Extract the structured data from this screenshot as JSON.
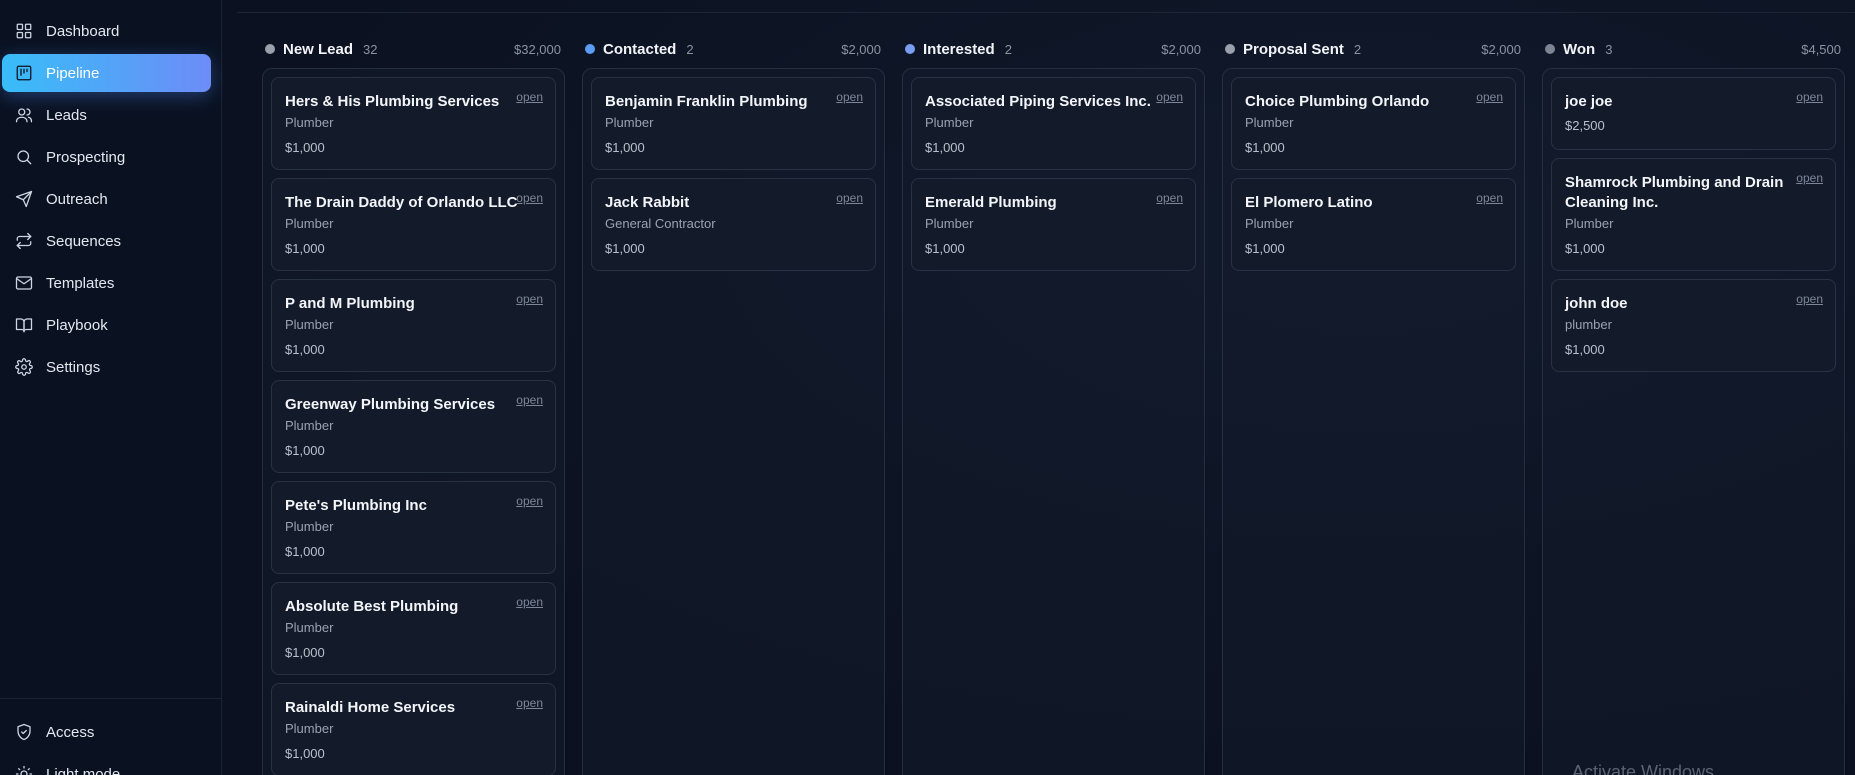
{
  "sidebar": {
    "items": [
      {
        "label": "Dashboard",
        "icon": "dashboard-icon",
        "active": false
      },
      {
        "label": "Pipeline",
        "icon": "pipeline-icon",
        "active": true
      },
      {
        "label": "Leads",
        "icon": "users-icon",
        "active": false
      },
      {
        "label": "Prospecting",
        "icon": "search-icon",
        "active": false
      },
      {
        "label": "Outreach",
        "icon": "send-icon",
        "active": false
      },
      {
        "label": "Sequences",
        "icon": "repeat-icon",
        "active": false
      },
      {
        "label": "Templates",
        "icon": "mail-icon",
        "active": false
      },
      {
        "label": "Playbook",
        "icon": "book-icon",
        "active": false
      },
      {
        "label": "Settings",
        "icon": "gear-icon",
        "active": false
      }
    ],
    "bottom": [
      {
        "label": "Access",
        "icon": "shield-icon"
      },
      {
        "label": "Light mode",
        "icon": "sun-icon"
      }
    ]
  },
  "columns": [
    {
      "title": "New Lead",
      "count": "32",
      "total": "$32,000",
      "dot_color": "#9aa1ad",
      "cards": [
        {
          "name": "Hers & His Plumbing Services",
          "type": "Plumber",
          "value": "$1,000",
          "action": "open"
        },
        {
          "name": "The Drain Daddy of Orlando LLC",
          "type": "Plumber",
          "value": "$1,000",
          "action": "open"
        },
        {
          "name": "P and M Plumbing",
          "type": "Plumber",
          "value": "$1,000",
          "action": "open"
        },
        {
          "name": "Greenway Plumbing Services",
          "type": "Plumber",
          "value": "$1,000",
          "action": "open"
        },
        {
          "name": "Pete's Plumbing Inc",
          "type": "Plumber",
          "value": "$1,000",
          "action": "open"
        },
        {
          "name": "Absolute Best Plumbing",
          "type": "Plumber",
          "value": "$1,000",
          "action": "open"
        },
        {
          "name": "Rainaldi Home Services",
          "type": "Plumber",
          "value": "$1,000",
          "action": "open"
        }
      ]
    },
    {
      "title": "Contacted",
      "count": "2",
      "total": "$2,000",
      "dot_color": "#5b9cf5",
      "cards": [
        {
          "name": "Benjamin Franklin Plumbing",
          "type": "Plumber",
          "value": "$1,000",
          "action": "open"
        },
        {
          "name": "Jack Rabbit",
          "type": "General Contractor",
          "value": "$1,000",
          "action": "open"
        }
      ]
    },
    {
      "title": "Interested",
      "count": "2",
      "total": "$2,000",
      "dot_color": "#7b9df0",
      "cards": [
        {
          "name": "Associated Piping Services Inc.",
          "type": "Plumber",
          "value": "$1,000",
          "action": "open"
        },
        {
          "name": "Emerald Plumbing",
          "type": "Plumber",
          "value": "$1,000",
          "action": "open"
        }
      ]
    },
    {
      "title": "Proposal Sent",
      "count": "2",
      "total": "$2,000",
      "dot_color": "#9aa1ad",
      "cards": [
        {
          "name": "Choice Plumbing Orlando",
          "type": "Plumber",
          "value": "$1,000",
          "action": "open"
        },
        {
          "name": "El Plomero Latino",
          "type": "Plumber",
          "value": "$1,000",
          "action": "open"
        }
      ]
    },
    {
      "title": "Won",
      "count": "3",
      "total": "$4,500",
      "dot_color": "#7d8492",
      "cards": [
        {
          "name": "joe joe",
          "type": "",
          "value": "$2,500",
          "action": "open",
          "size": "small"
        },
        {
          "name": "Shamrock Plumbing and Drain Cleaning Inc.",
          "type": "Plumber",
          "value": "$1,000",
          "action": "open",
          "size": "tall"
        },
        {
          "name": "john doe",
          "type": "plumber",
          "value": "$1,000",
          "action": "open"
        }
      ]
    }
  ],
  "watermark": "Activate Windows"
}
